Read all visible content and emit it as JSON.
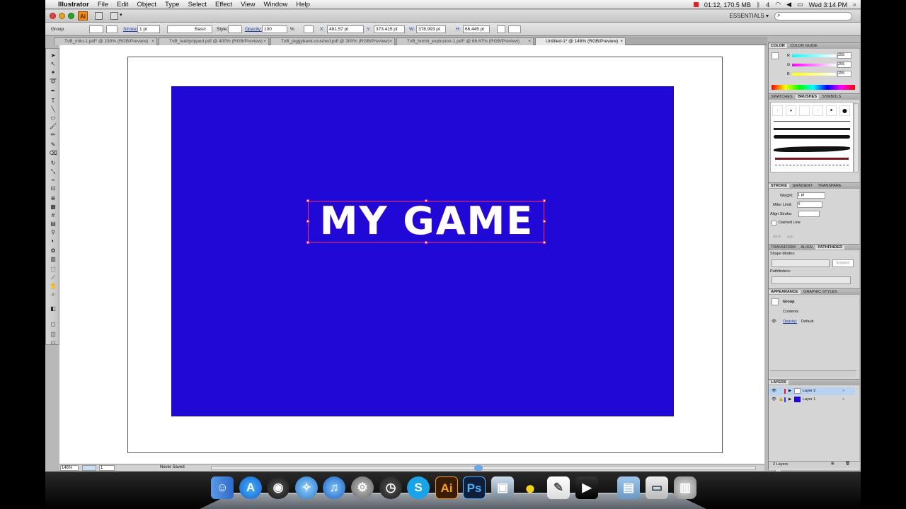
{
  "menubar": {
    "apple": "",
    "app": "Illustrator",
    "items": [
      "File",
      "Edit",
      "Object",
      "Type",
      "Select",
      "Effect",
      "View",
      "Window",
      "Help"
    ],
    "status": "01:12, 170.5 MB",
    "battery": "4",
    "clock": "Wed 3:14 PM"
  },
  "appbar": {
    "logo": "Ai",
    "workspace": "ESSENTIALS ▾",
    "search_placeholder": ""
  },
  "control": {
    "selection": "Group",
    "stroke_label": "Stroke:",
    "stroke_weight": "1 pt",
    "brush": "Basic",
    "style_label": "Style:",
    "opacity_label": "Opacity:",
    "opacity": "100",
    "opacity_unit": "%",
    "x_label": "X:",
    "x": "481.57 pt",
    "y_label": "Y:",
    "y": "373.415 pt",
    "w_label": "W:",
    "w": "378.993 pt",
    "h_label": "H:",
    "h": "66.445 pt"
  },
  "tabs": [
    "TvB_milo-1.pdf* @ 150% (RGB/Preview)",
    "TvB_teddyripped.pdf @ 400% (RGB/Preview)",
    "TvB_piggybank-crushed.pdf @ 300% (RGB/Preview)",
    "TvB_bomb_explosion-1.pdf* @ 66.67% (RGB/Preview)",
    "Untitled-1* @ 146% (RGB/Preview)"
  ],
  "canvas": {
    "artwork_text": "MY GAME",
    "fill_color": "#2008d6"
  },
  "status": {
    "zoom": "146%",
    "artboard": "1",
    "save_state": "Never Saved"
  },
  "panels": {
    "color": {
      "tabs": [
        "COLOR",
        "COLOR GUIDE"
      ],
      "r_label": "R",
      "g_label": "G",
      "b_label": "B",
      "r": "255",
      "g": "255",
      "b": "255"
    },
    "brushes": {
      "tabs": [
        "SWATCHES",
        "BRUSHES",
        "SYMBOLS"
      ]
    },
    "stroke": {
      "tabs": [
        "STROKE",
        "GRADIENT",
        "TRANSPARE"
      ],
      "weight_label": "Weight:",
      "weight": "1 pt",
      "miter_label": "Miter Limit:",
      "miter": "4",
      "align_label": "Align Stroke:",
      "dashed": "Dashed Line",
      "dash": "dash",
      "gap": "gap"
    },
    "pathfinder": {
      "tabs": [
        "TRANSFORM",
        "ALIGN",
        "PATHFINDER"
      ],
      "shape_modes": "Shape Modes:",
      "expand": "Expand",
      "pathfinders": "Pathfinders:"
    },
    "appearance": {
      "tabs": [
        "APPEARANCE",
        "GRAPHIC STYLES"
      ],
      "group": "Group",
      "contents": "Contents",
      "opacity": "Opacity:",
      "opacity_value": "Default"
    },
    "layers": {
      "tab": "LAYERS",
      "items": [
        "Layer 2",
        "Layer 1"
      ],
      "count": "2 Layers"
    }
  },
  "dock": [
    "Finder",
    "App Store",
    "Dashboard",
    "Safari",
    "iTunes",
    "System Preferences",
    "Time Machine",
    "Skype",
    "Ai",
    "Ps",
    "Preview",
    "Cyberduck",
    "TextEdit",
    "Final Cut",
    "Applications",
    "Documents",
    "Trash"
  ]
}
